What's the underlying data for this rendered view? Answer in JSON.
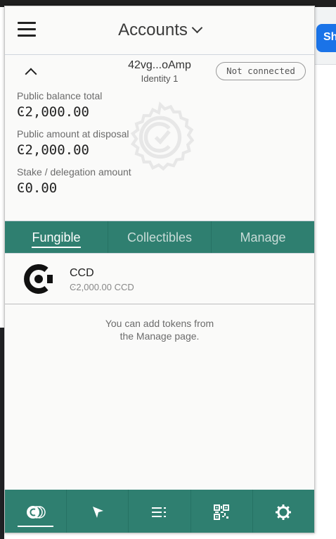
{
  "background": {
    "share_label": "Sh"
  },
  "header": {
    "title": "Accounts"
  },
  "account": {
    "address": "42vg...oAmp",
    "identity": "Identity 1",
    "connection_status": "Not connected",
    "balances": [
      {
        "label": "Public balance total",
        "value": "Ͼ2,000.00"
      },
      {
        "label": "Public amount at disposal",
        "value": "Ͼ2,000.00"
      },
      {
        "label": "Stake / delegation amount",
        "value": "Ͼ0.00"
      }
    ]
  },
  "tabs": [
    {
      "label": "Fungible",
      "active": true
    },
    {
      "label": "Collectibles",
      "active": false
    },
    {
      "label": "Manage",
      "active": false
    }
  ],
  "tokens": [
    {
      "name": "CCD",
      "amount": "Ͼ2,000.00 CCD"
    }
  ],
  "hint": {
    "line1": "You can add tokens from",
    "line2": "the Manage page."
  },
  "bottom_nav": [
    {
      "icon": "ccd-coins-icon",
      "active": true
    },
    {
      "icon": "send-cursor-icon",
      "active": false
    },
    {
      "icon": "transaction-list-icon",
      "active": false
    },
    {
      "icon": "qr-code-icon",
      "active": false
    },
    {
      "icon": "settings-gear-icon",
      "active": false
    }
  ],
  "colors": {
    "accent": "#2f7f70",
    "background": "#fafaf9",
    "text": "#222222"
  }
}
